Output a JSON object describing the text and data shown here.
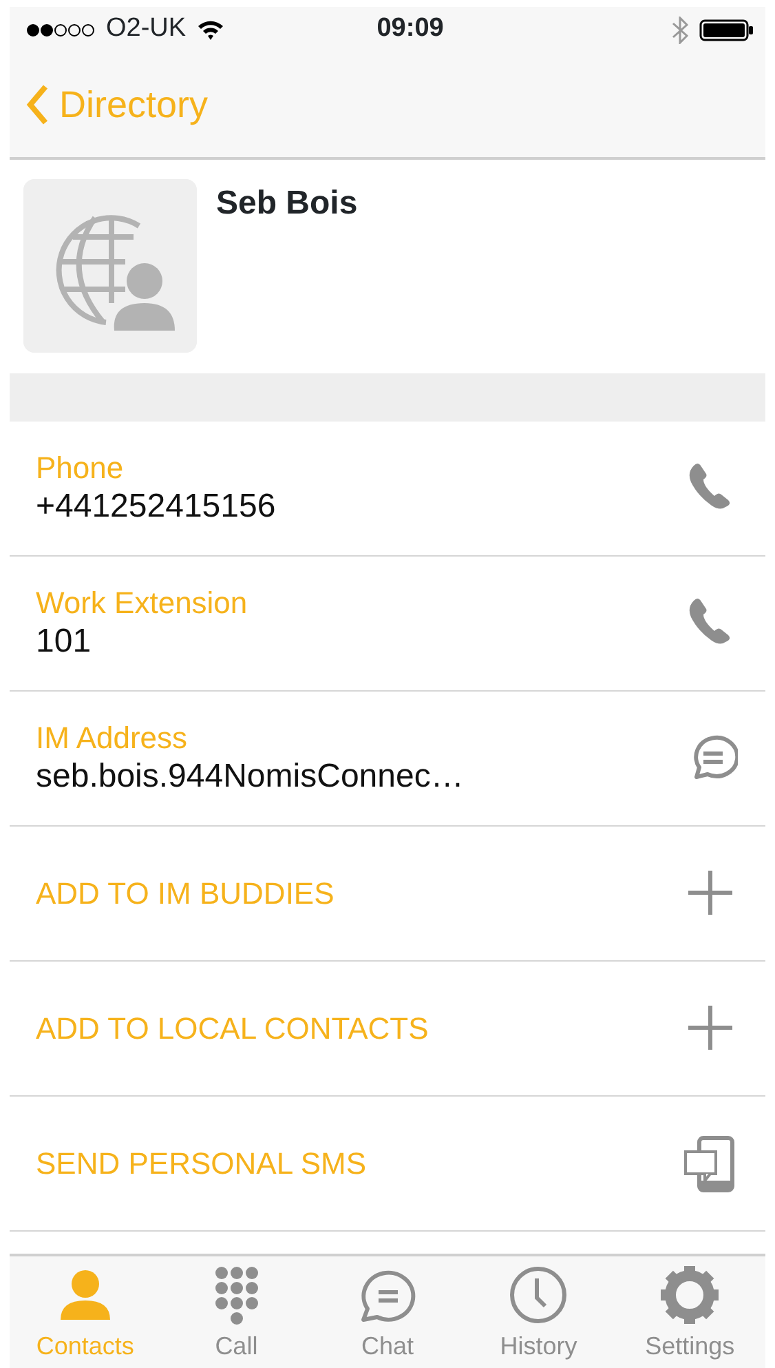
{
  "status_bar": {
    "carrier": "O2-UK",
    "time": "09:09"
  },
  "nav": {
    "back_label": "Directory"
  },
  "contact": {
    "name": "Seb Bois"
  },
  "rows": [
    {
      "kind": "call",
      "label": "Phone",
      "value": "+441252415156"
    },
    {
      "kind": "call",
      "label": "Work Extension",
      "value": "101"
    },
    {
      "kind": "chat",
      "label": "IM Address",
      "value": "seb.bois.944NomisConnec…"
    },
    {
      "kind": "add",
      "label": "ADD TO IM BUDDIES"
    },
    {
      "kind": "add",
      "label": "ADD TO LOCAL CONTACTS"
    },
    {
      "kind": "sms",
      "label": "SEND PERSONAL SMS"
    }
  ],
  "tabs": [
    {
      "label": "Contacts",
      "selected": true
    },
    {
      "label": "Call",
      "selected": false
    },
    {
      "label": "Chat",
      "selected": false
    },
    {
      "label": "History",
      "selected": false
    },
    {
      "label": "Settings",
      "selected": false
    }
  ]
}
